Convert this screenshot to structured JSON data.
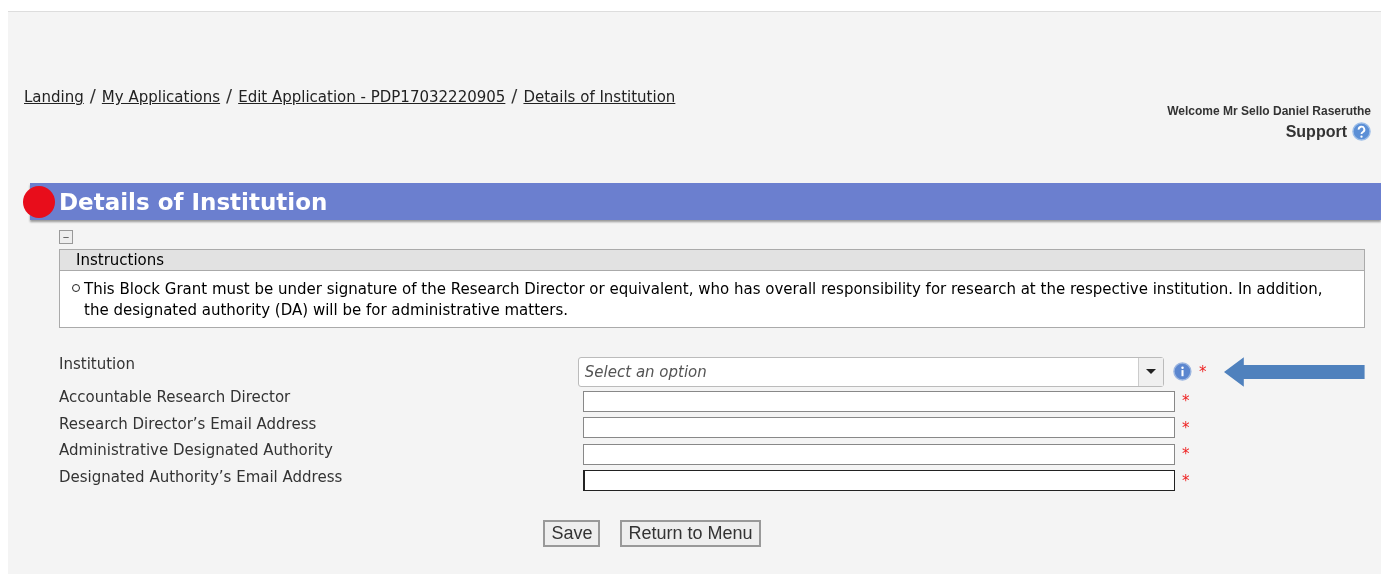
{
  "breadcrumb": [
    {
      "label": "Landing"
    },
    {
      "label": "My Applications"
    },
    {
      "label": "Edit Application - PDP17032220905"
    },
    {
      "label": "Details of Institution"
    }
  ],
  "breadcrumb_separator": "/",
  "user": {
    "welcome": "Welcome Mr Sello Daniel Raseruthe",
    "support": "Support"
  },
  "section": {
    "title": "Details of Institution",
    "collapse_symbol": "−"
  },
  "instructions": {
    "title": "Instructions",
    "items": [
      "This Block Grant must be under signature of the Research Director or equivalent, who has overall responsibility for research at the respective institution. In addition, the designated authority (DA) will be for administrative matters."
    ]
  },
  "fields": [
    {
      "label": "Institution",
      "kind": "select",
      "placeholder": "Select an option",
      "info": true,
      "required": "*",
      "focused": false,
      "pointer": true
    },
    {
      "label": "Accountable Research Director",
      "kind": "text",
      "info": false,
      "required": "*",
      "focused": false,
      "pointer": false
    },
    {
      "label": "Research Director’s Email Address",
      "kind": "text",
      "info": false,
      "required": "*",
      "focused": false,
      "pointer": false
    },
    {
      "label": "Administrative Designated Authority",
      "kind": "text",
      "info": false,
      "required": "*",
      "focused": false,
      "pointer": false
    },
    {
      "label": "Designated Authority’s Email Address",
      "kind": "text",
      "info": false,
      "required": "*",
      "focused": true,
      "pointer": false
    }
  ],
  "buttons": [
    "Save",
    "Return to Menu"
  ]
}
